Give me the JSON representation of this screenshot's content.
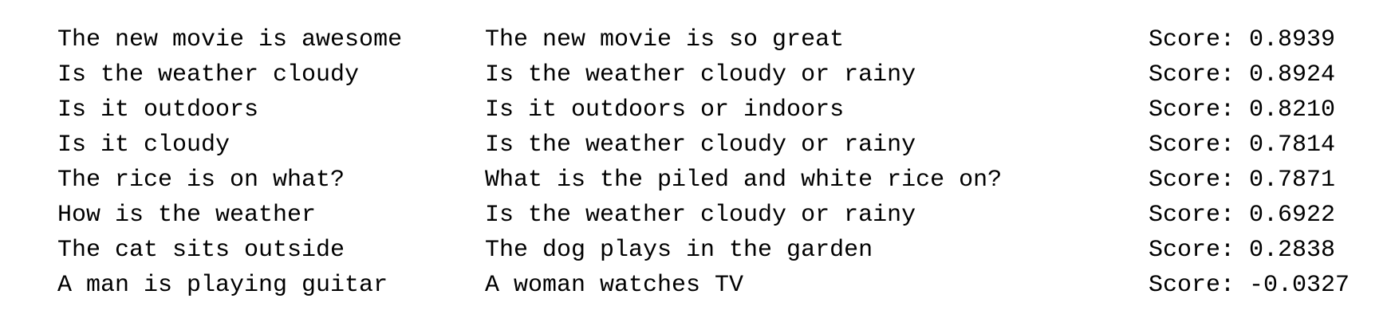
{
  "score_prefix": "Score: ",
  "rows": [
    {
      "sentence_a": "The new movie is awesome",
      "sentence_b": "The new movie is so great",
      "score": "0.8939"
    },
    {
      "sentence_a": "Is the weather cloudy",
      "sentence_b": "Is the weather cloudy or rainy",
      "score": "0.8924"
    },
    {
      "sentence_a": "Is it outdoors",
      "sentence_b": "Is it outdoors or indoors",
      "score": "0.8210"
    },
    {
      "sentence_a": "Is it cloudy",
      "sentence_b": "Is the weather cloudy or rainy",
      "score": "0.7814"
    },
    {
      "sentence_a": "The rice is on what?",
      "sentence_b": "What is the piled and white rice on?",
      "score": "0.7871"
    },
    {
      "sentence_a": "How is the weather",
      "sentence_b": "Is the weather cloudy or rainy",
      "score": "0.6922"
    },
    {
      "sentence_a": "The cat sits outside",
      "sentence_b": "The dog plays in the garden",
      "score": "0.2838"
    },
    {
      "sentence_a": "A man is playing guitar",
      "sentence_b": "A woman watches TV",
      "score": "-0.0327"
    }
  ]
}
